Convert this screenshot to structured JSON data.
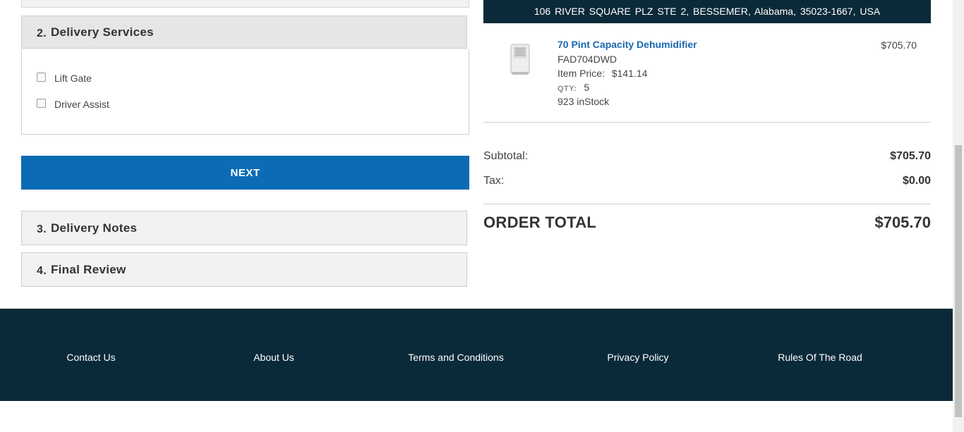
{
  "delivery": {
    "section2_number": "2.",
    "section2_title": "Delivery Services",
    "options": [
      "Lift Gate",
      "Driver Assist"
    ],
    "next_label": "NEXT",
    "section3_number": "3.",
    "section3_title": "Delivery Notes",
    "section4_number": "4.",
    "section4_title": "Final Review"
  },
  "shipping": {
    "address": "106 RIVER SQUARE PLZ STE 2,  BESSEMER,  Alabama,  35023-1667,  USA"
  },
  "product": {
    "name": "70 Pint Capacity Dehumidifier",
    "sku": "FAD704DWD",
    "item_price_label": "Item Price:",
    "item_price": "$141.14",
    "qty_label": "QTY:",
    "qty": "5",
    "stock": "923 inStock",
    "line_total": "$705.70"
  },
  "summary": {
    "subtotal_label": "Subtotal:",
    "subtotal": "$705.70",
    "tax_label": "Tax:",
    "tax": "$0.00",
    "order_total_label": "ORDER TOTAL",
    "order_total": "$705.70"
  },
  "footer": {
    "links": [
      "Contact Us",
      "About Us",
      "Terms and Conditions",
      "Privacy Policy",
      "Rules Of The Road"
    ]
  },
  "colors": {
    "primary_button": "#0b6bb5",
    "dark_navy": "#0b2a39",
    "link_blue": "#1a67b0"
  }
}
